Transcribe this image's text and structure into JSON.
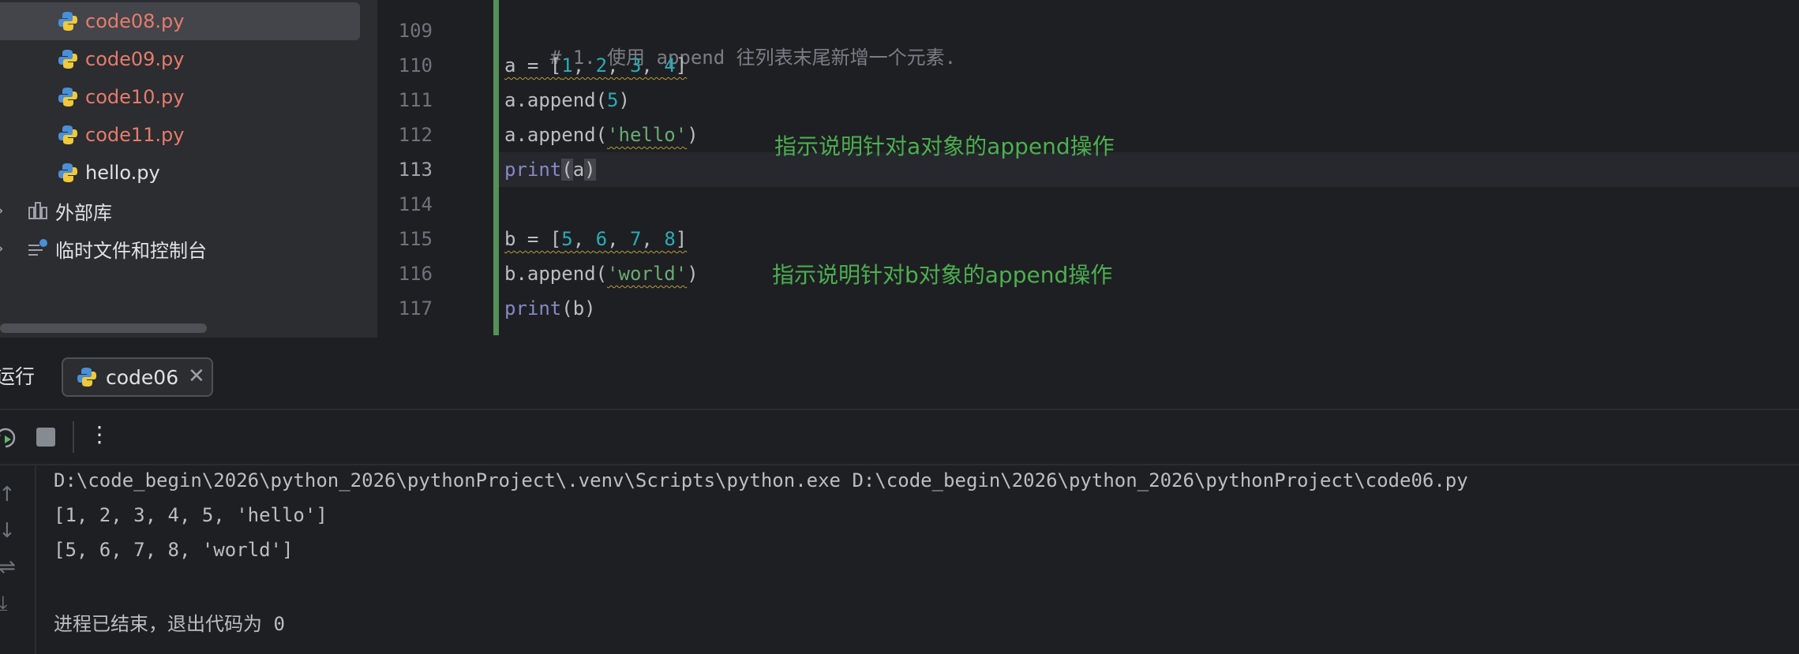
{
  "project_tree": {
    "files": [
      {
        "name": "code08.py",
        "selected": true,
        "color": "#e77b6d"
      },
      {
        "name": "code09.py",
        "selected": false,
        "color": "#e77b6d"
      },
      {
        "name": "code10.py",
        "selected": false,
        "color": "#e77b6d"
      },
      {
        "name": "code11.py",
        "selected": false,
        "color": "#e77b6d"
      },
      {
        "name": "hello.py",
        "selected": false,
        "color": "#dfe1e5"
      }
    ],
    "nodes": [
      {
        "label": "外部库",
        "icon": "library-icon"
      },
      {
        "label": "临时文件和控制台",
        "icon": "scratches-icon"
      }
    ]
  },
  "editor": {
    "line_numbers": [
      "109",
      "110",
      "111",
      "112",
      "113",
      "114",
      "115",
      "116",
      "117"
    ],
    "current_line": "113",
    "lines": {
      "l109": "# 1. 使用 append 往列表末尾新增一个元素.",
      "l110": {
        "a": "a",
        "eq": " = [",
        "n1": "1",
        "s1": ", ",
        "n2": "2",
        "s2": ", ",
        "n3": "3",
        "s3": ", ",
        "n4": "4",
        "close": "]"
      },
      "l111": {
        "pre": "a.append(",
        "n": "5",
        "post": ")"
      },
      "l112": {
        "pre": "a.append(",
        "str": "'hello'",
        "post": ")"
      },
      "l113": {
        "kw": "print",
        "open": "(",
        "arg": "a",
        "close": ")"
      },
      "l115": {
        "a": "b",
        "eq": " = [",
        "n1": "5",
        "s1": ", ",
        "n2": "6",
        "s2": ", ",
        "n3": "7",
        "s3": ", ",
        "n4": "8",
        "close": "]"
      },
      "l116": {
        "pre": "b.append(",
        "str": "'world'",
        "post": ")"
      },
      "l117": {
        "kw": "print",
        "rest": "(b)"
      }
    },
    "annotations": {
      "a": "指示说明针对a对象的append操作",
      "b": "指示说明针对b对象的append操作"
    },
    "colors": {
      "number": "#2aacb8",
      "string": "#6aab73",
      "keyword": "#8888c6",
      "comment": "#7a7e85",
      "annotation": "#4caf50"
    }
  },
  "run_panel": {
    "title": "运行",
    "tab_label": "code06",
    "tab_close": "✕",
    "output": [
      "D:\\code_begin\\2026\\python_2026\\pythonProject\\.venv\\Scripts\\python.exe D:\\code_begin\\2026\\python_2026\\pythonProject\\code06.py",
      "[1, 2, 3, 4, 5, 'hello']",
      "[5, 6, 7, 8, 'world']",
      "",
      "进程已结束，退出代码为 0"
    ]
  }
}
